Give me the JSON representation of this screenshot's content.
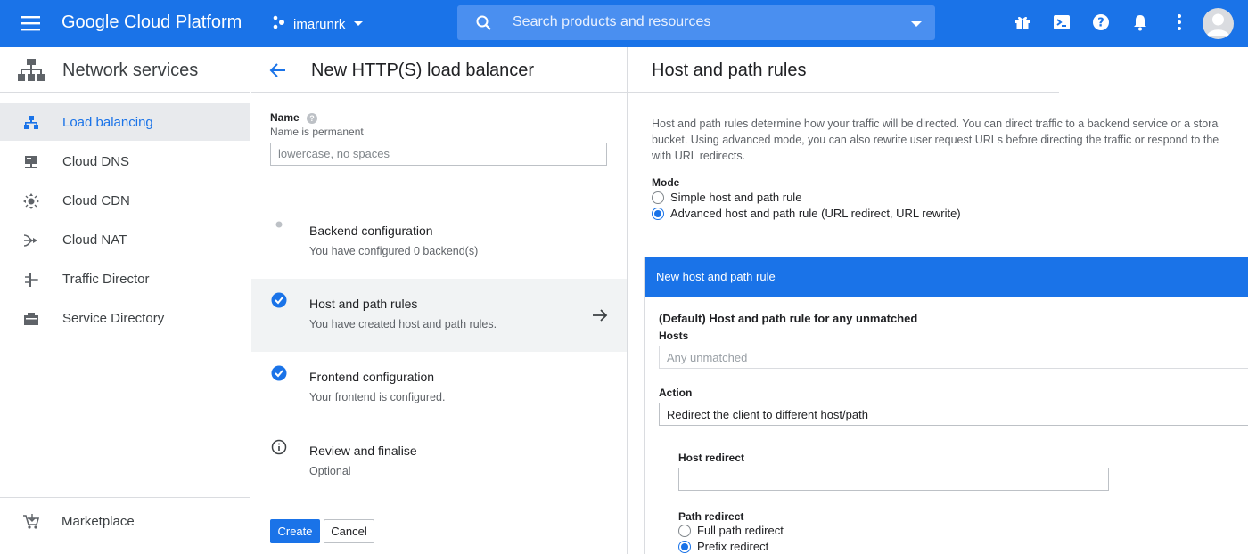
{
  "topbar": {
    "brand": "Google Cloud Platform",
    "project": "imarunrk",
    "search_placeholder": "Search products and resources",
    "icons": [
      "menu-icon",
      "gift-icon",
      "cloud-shell-icon",
      "help-icon",
      "notifications-icon",
      "more-vert-icon",
      "avatar"
    ]
  },
  "sidebar": {
    "title": "Network services",
    "items": [
      {
        "label": "Load balancing",
        "icon": "load-balancing-icon",
        "active": true
      },
      {
        "label": "Cloud DNS",
        "icon": "dns-icon",
        "active": false
      },
      {
        "label": "Cloud CDN",
        "icon": "cdn-icon",
        "active": false
      },
      {
        "label": "Cloud NAT",
        "icon": "nat-icon",
        "active": false
      },
      {
        "label": "Traffic Director",
        "icon": "traffic-director-icon",
        "active": false
      },
      {
        "label": "Service Directory",
        "icon": "service-directory-icon",
        "active": false
      }
    ],
    "marketplace": "Marketplace"
  },
  "wizard": {
    "title": "New HTTP(S) load balancer",
    "name_label": "Name",
    "name_hint": "Name is permanent",
    "name_placeholder": "lowercase, no spaces",
    "steps": [
      {
        "title": "Backend configuration",
        "desc": "You have configured 0 backend(s)",
        "status": "pending"
      },
      {
        "title": "Host and path rules",
        "desc": "You have created host and path rules.",
        "status": "done"
      },
      {
        "title": "Frontend configuration",
        "desc": "Your frontend is configured.",
        "status": "done"
      },
      {
        "title": "Review and finalise",
        "desc": "Optional",
        "status": "info"
      }
    ],
    "create_label": "Create",
    "cancel_label": "Cancel"
  },
  "rules": {
    "title": "Host and path rules",
    "description_lines": [
      "Host and path rules determine how your traffic will be directed. You can direct traffic to a backend service or a stora",
      "bucket. Using advanced mode, you can also rewrite user request URLs before directing the traffic or respond to the",
      "with URL redirects."
    ],
    "mode_label": "Mode",
    "mode_options": [
      {
        "label": "Simple host and path rule",
        "selected": false
      },
      {
        "label": "Advanced host and path rule (URL redirect, URL rewrite)",
        "selected": true
      }
    ],
    "panel": {
      "header": "New host and path rule",
      "title": "(Default) Host and path rule for any unmatched",
      "hosts_label": "Hosts",
      "hosts_placeholder": "Any unmatched",
      "action_label": "Action",
      "action_value": "Redirect the client to different host/path",
      "host_redirect_label": "Host redirect",
      "host_redirect_value": "",
      "path_redirect_label": "Path redirect",
      "path_options": [
        {
          "label": "Full path redirect",
          "selected": false
        },
        {
          "label": "Prefix redirect",
          "selected": true
        }
      ]
    }
  },
  "colors": {
    "accent": "#1a73e8",
    "active_nav_bg": "#e8eaed"
  }
}
